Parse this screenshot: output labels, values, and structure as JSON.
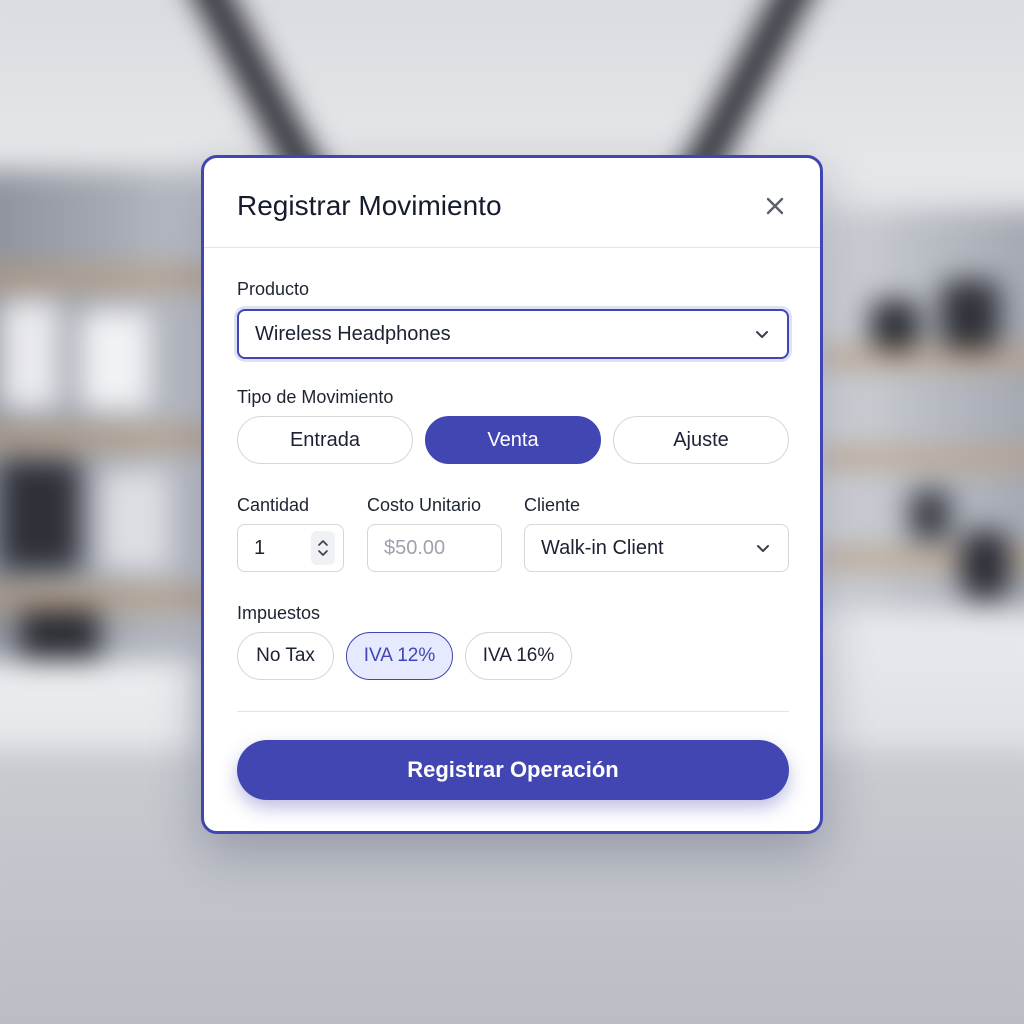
{
  "modal": {
    "title": "Registrar Movimiento",
    "close_icon": "close-icon"
  },
  "product": {
    "label": "Producto",
    "value": "Wireless Headphones"
  },
  "movement_type": {
    "label": "Tipo de Movimiento",
    "options": [
      "Entrada",
      "Venta",
      "Ajuste"
    ],
    "selected": "Venta"
  },
  "quantity": {
    "label": "Cantidad",
    "value": "1"
  },
  "unit_cost": {
    "label": "Costo Unitario",
    "placeholder": "$50.00"
  },
  "client": {
    "label": "Cliente",
    "value": "Walk-in Client"
  },
  "taxes": {
    "label": "Impuestos",
    "options": [
      "No Tax",
      "IVA 12%",
      "IVA 16%"
    ],
    "selected": "IVA 12%"
  },
  "submit": {
    "label": "Registrar Operación"
  },
  "colors": {
    "accent": "#4146b2",
    "accent_light": "#e6eaff"
  }
}
